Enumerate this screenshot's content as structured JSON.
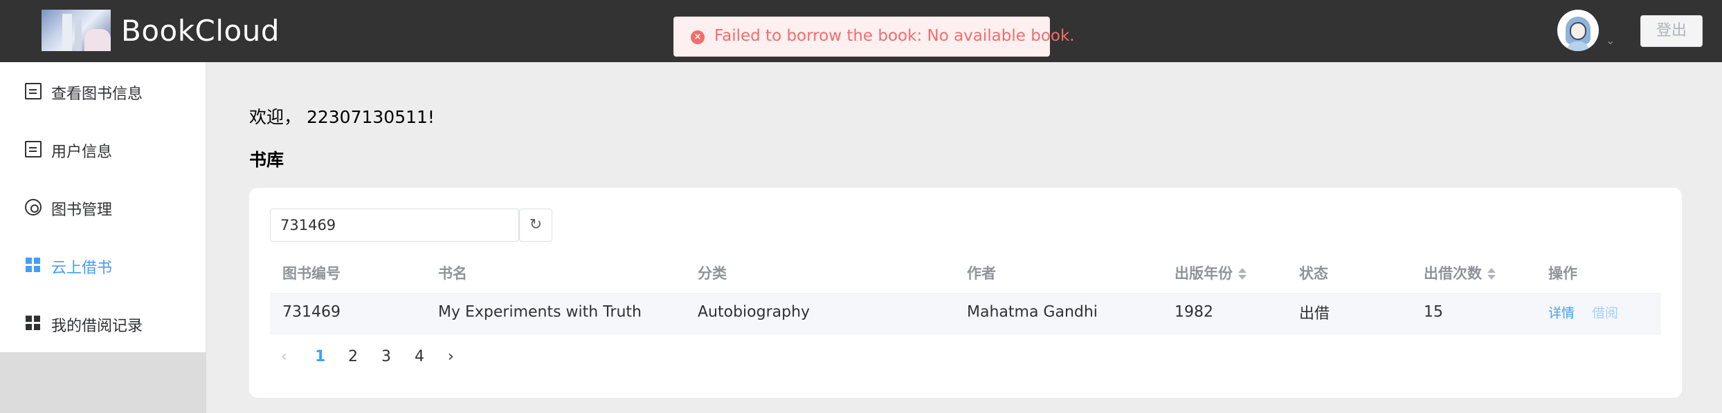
{
  "header": {
    "app_name": "BookCloud",
    "logout_label": "登出"
  },
  "toast": {
    "message": "Failed to borrow the book: No available book.",
    "icon": "close-circle-icon",
    "color": "#f56c6c"
  },
  "sidebar": {
    "items": [
      {
        "label": "查看图书信息",
        "icon": "document-icon",
        "active": false
      },
      {
        "label": "用户信息",
        "icon": "document-icon",
        "active": false
      },
      {
        "label": "图书管理",
        "icon": "gear-icon",
        "active": false
      },
      {
        "label": "云上借书",
        "icon": "grid-icon",
        "active": true
      },
      {
        "label": "我的借阅记录",
        "icon": "grid-icon",
        "active": false
      }
    ],
    "active_color": "#409eff"
  },
  "main": {
    "welcome": "欢迎， 22307130511!",
    "section_title": "书库",
    "search": {
      "value": "731469",
      "placeholder": ""
    },
    "table": {
      "columns": [
        "图书编号",
        "书名",
        "分类",
        "作者",
        "出版年份",
        "状态",
        "出借次数",
        "操作"
      ],
      "rows": [
        {
          "id": "731469",
          "title": "My Experiments with Truth",
          "category": "Autobiography",
          "author": "Mahatma Gandhi",
          "year": "1982",
          "status": "出借",
          "borrow_count": "15",
          "action_detail": "详情",
          "action_borrow": "借阅"
        }
      ]
    },
    "pagination": {
      "pages": [
        "1",
        "2",
        "3",
        "4"
      ],
      "current": "1",
      "prev": "‹",
      "next": "›"
    }
  }
}
